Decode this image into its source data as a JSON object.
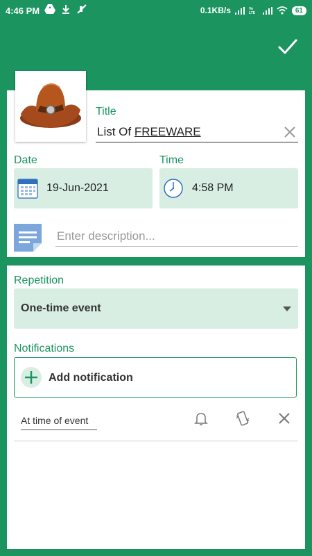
{
  "status_bar": {
    "time": "4:46 PM",
    "speed": "0.1KB/s",
    "battery": "61",
    "icons": [
      "drive-icon",
      "download-icon",
      "mute-icon",
      "signal-icon",
      "volte-icon",
      "signal-icon",
      "wifi-icon",
      "battery-icon"
    ]
  },
  "header": {
    "confirm_icon": "checkmark-icon"
  },
  "event": {
    "title_label": "Title",
    "title_value_plain": "List Of ",
    "title_value_underlined": "FREEWARE",
    "date_label": "Date",
    "date_value": "19-Jun-2021",
    "time_label": "Time",
    "time_value": "4:58 PM",
    "description_placeholder": "Enter description..."
  },
  "repetition": {
    "label": "Repetition",
    "selected": "One-time event"
  },
  "notifications": {
    "label": "Notifications",
    "add_label": "Add notification",
    "items": [
      {
        "timing": "At time of event"
      }
    ]
  },
  "colors": {
    "accent": "#1b9460",
    "field_bg": "#d9eee3"
  }
}
